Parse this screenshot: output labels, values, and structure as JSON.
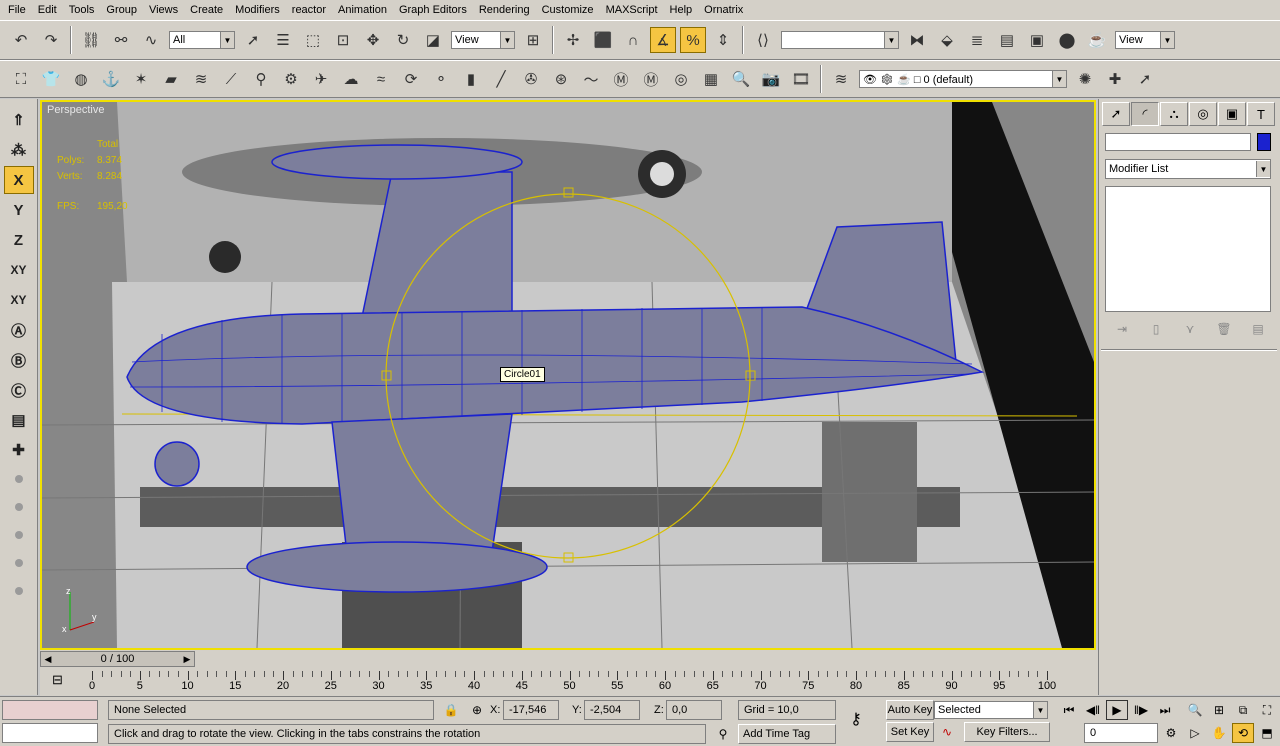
{
  "menu": [
    "File",
    "Edit",
    "Tools",
    "Group",
    "Views",
    "Create",
    "Modifiers",
    "reactor",
    "Animation",
    "Graph Editors",
    "Rendering",
    "Customize",
    "MAXScript",
    "Help",
    "Ornatrix"
  ],
  "toolbar1": {
    "selection_filter": "All",
    "ref_coord": "View",
    "named_selection": "",
    "ref_coord_right": "View"
  },
  "toolbar2": {
    "layer_value": "0 (default)"
  },
  "left_toolbar": {
    "axis_x": "X",
    "axis_y": "Y",
    "axis_z": "Z",
    "axis_xy": "XY",
    "axis_xy2": "XY"
  },
  "viewport": {
    "label": "Perspective",
    "stats": {
      "header": "Total",
      "polys_label": "Polys:",
      "polys_value": "8.374",
      "verts_label": "Verts:",
      "verts_value": "8.284",
      "fps_label": "FPS:",
      "fps_value": "195,20"
    },
    "object_label": "Circle01",
    "axis_labels": {
      "z": "z",
      "x": "x",
      "y": "y"
    }
  },
  "command_panel": {
    "modifier_list": "Modifier List"
  },
  "time": {
    "frame_label": "0 / 100",
    "ticks": [
      0,
      5,
      10,
      15,
      20,
      25,
      30,
      35,
      40,
      45,
      50,
      55,
      60,
      65,
      70,
      75,
      80,
      85,
      90,
      95,
      100
    ]
  },
  "status": {
    "selection": "None Selected",
    "prompt": "Click and drag to rotate the view.  Clicking in the tabs constrains the rotation",
    "x_label": "X:",
    "x_value": "-17,546",
    "y_label": "Y:",
    "y_value": "-2,504",
    "z_label": "Z:",
    "z_value": "0,0",
    "grid": "Grid = 10,0",
    "add_time_tag": "Add Time Tag",
    "auto_key": "Auto Key",
    "auto_key_mode": "Selected",
    "set_key": "Set Key",
    "key_filters": "Key Filters...",
    "current_frame": "0"
  },
  "colors": {
    "accent_active": "#f5c542",
    "viewport_border": "#f0e000",
    "wire": "#1b22cf",
    "stats_text": "#d8c000"
  }
}
